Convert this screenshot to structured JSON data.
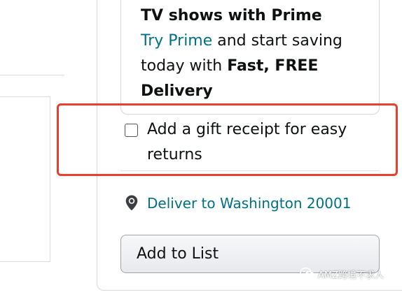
{
  "prime_card": {
    "line1": "TV shows with Prime",
    "try_prime_link": "Try Prime",
    "text_after_link": " and start saving",
    "text_line3": "today with ",
    "fast_free": "Fast, FREE",
    "delivery": "Delivery"
  },
  "gift_receipt": {
    "checked": false,
    "label": "Add a gift receipt for easy returns"
  },
  "deliver": {
    "icon": "location-pin-icon",
    "label": "Deliver to Washington 20001"
  },
  "add_to_list": {
    "label": "Add to List"
  },
  "watermark": {
    "icon": "wechat-icon",
    "text": "AMZ跨境不求人"
  },
  "colors": {
    "link": "#007185",
    "highlight": "#e8402f",
    "border": "#d5d9d9"
  }
}
